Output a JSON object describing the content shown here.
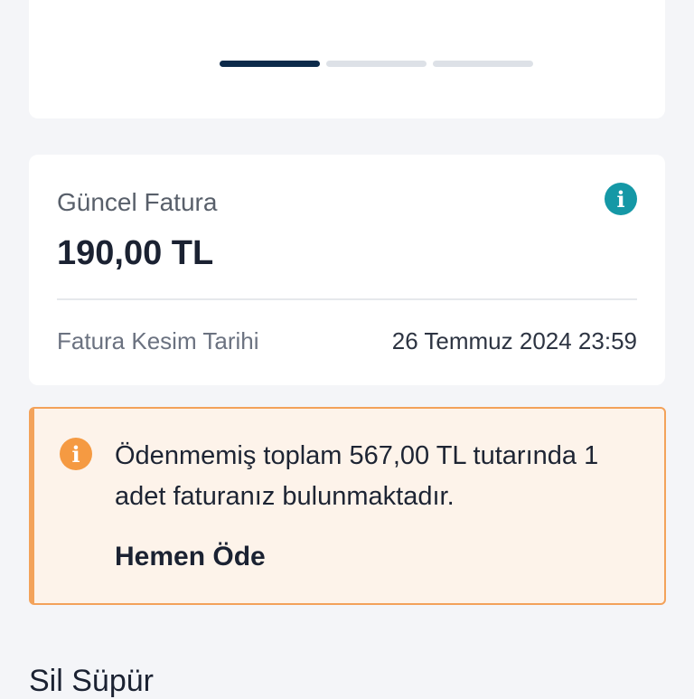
{
  "invoice": {
    "title": "Güncel Fatura",
    "amount": "190,00 TL",
    "cutoff_label": "Fatura Kesim Tarihi",
    "cutoff_value": "26 Temmuz 2024 23:59",
    "info_icon": "i"
  },
  "alert": {
    "icon": "i",
    "message": "Ödenmemiş toplam 567,00 TL tutarında 1 adet faturanız bulunmaktadır.",
    "action_label": "Hemen Öde"
  },
  "section": {
    "title": "Sil Süpür"
  },
  "colors": {
    "accent_teal": "#1598a6",
    "warning_orange": "#f59a42",
    "pager_active": "#0c2a4a"
  }
}
